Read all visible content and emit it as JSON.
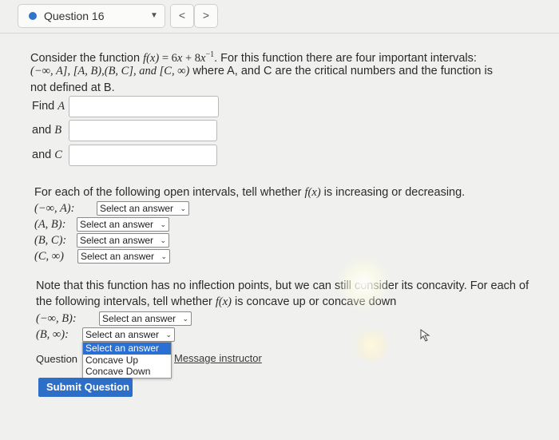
{
  "nav": {
    "question_label": "Question 16",
    "prev": "<",
    "next": ">"
  },
  "intro": {
    "l1_a": "Consider the function ",
    "l1_fx": "f(x)",
    "l1_eq": " = 6",
    "l1_x1": "x",
    "l1_plus": " + 8",
    "l1_x2": "x",
    "l1_exp": "−1",
    "l1_b": ". For this function there are four important intervals:",
    "l2": "(−∞, A], [A, B),(B, C], and [C, ∞)",
    "l2_b": " where A, and C are the critical numbers and the function is",
    "l3": "not defined at B."
  },
  "fields": [
    {
      "label": "Find",
      "var": "A",
      "value": ""
    },
    {
      "label": "and",
      "var": "B",
      "value": ""
    },
    {
      "label": "and",
      "var": "C",
      "value": ""
    }
  ],
  "inc": {
    "prompt_a": "For each of the following open intervals, tell whether ",
    "prompt_f": "f(x)",
    "prompt_b": " is increasing or decreasing.",
    "rows": [
      {
        "interval": "(−∞, A):",
        "value": "Select an answer"
      },
      {
        "interval": "(A, B):",
        "value": "Select an answer"
      },
      {
        "interval": "(B, C):",
        "value": "Select an answer"
      },
      {
        "interval": "(C, ∞)",
        "value": "Select an answer"
      }
    ]
  },
  "conc": {
    "l1": "Note that this function has no inflection points, but we can still consider its concavity. For each of",
    "l2_a": "the following intervals, tell whether ",
    "l2_f": "f(x)",
    "l2_b": " is concave up or concave down",
    "rows": [
      {
        "interval": "(−∞, B):",
        "value": "Select an answer"
      },
      {
        "interval": "(B, ∞):",
        "value": "Select an answer"
      }
    ],
    "options": [
      "Select an answer",
      "Concave Up",
      "Concave Down"
    ]
  },
  "footer": {
    "question_prefix": "Question",
    "message": "Message instructor",
    "submit": "Submit Question"
  }
}
